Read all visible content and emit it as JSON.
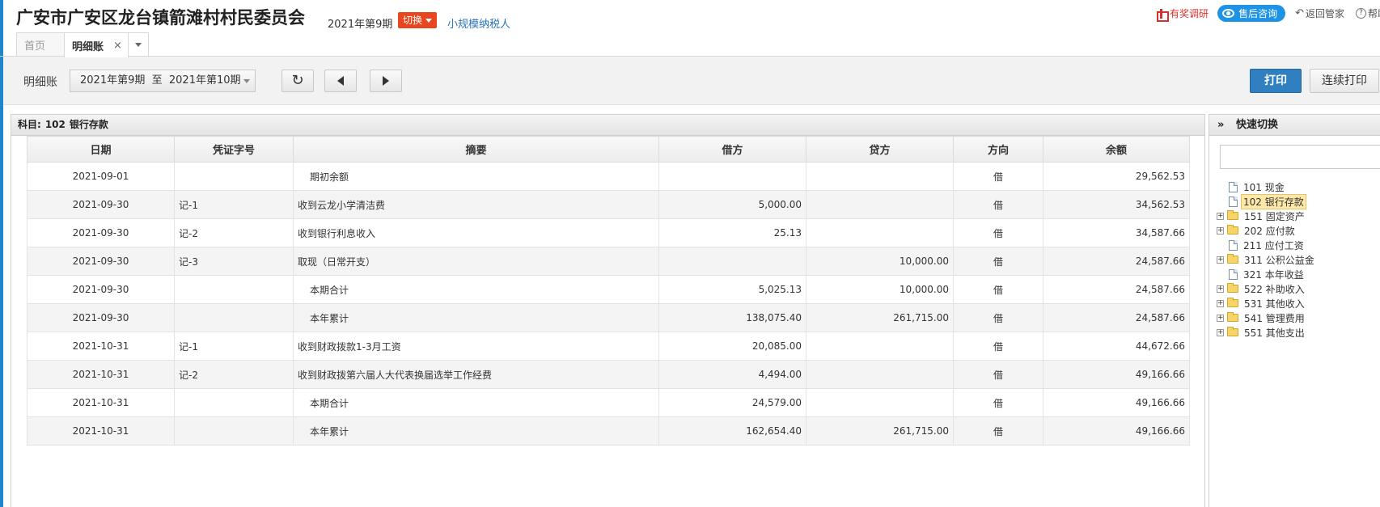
{
  "header": {
    "company": "广安市广安区龙台镇箭滩村村民委员会",
    "period": "2021年第9期",
    "switch_label": "切换",
    "taxpayer": "小规模纳税人",
    "survey": "有奖调研",
    "service": "售后咨询",
    "back": "返回管家",
    "help": "帮助"
  },
  "tabs": {
    "home": "首页",
    "active": "明细账",
    "close": "×"
  },
  "toolbar": {
    "label": "明细账",
    "range": "2021年第9期  至  2021年第10期",
    "print": "打印",
    "continuous_print": "连续打印"
  },
  "main": {
    "subject_prefix": "科目:",
    "subject_code": "102",
    "subject_name": "银行存款",
    "columns": [
      "日期",
      "凭证字号",
      "摘要",
      "借方",
      "贷方",
      "方向",
      "余额"
    ],
    "rows": [
      {
        "date": "2021-09-01",
        "voucher": "",
        "summary": "期初余额",
        "debit": "",
        "credit": "",
        "dir": "借",
        "balance": "29,562.53",
        "indent": true
      },
      {
        "date": "2021-09-30",
        "voucher": "记-1",
        "summary": "收到云龙小学清洁费",
        "debit": "5,000.00",
        "credit": "",
        "dir": "借",
        "balance": "34,562.53",
        "indent": false
      },
      {
        "date": "2021-09-30",
        "voucher": "记-2",
        "summary": "收到银行利息收入",
        "debit": "25.13",
        "credit": "",
        "dir": "借",
        "balance": "34,587.66",
        "indent": false
      },
      {
        "date": "2021-09-30",
        "voucher": "记-3",
        "summary": "取现（日常开支）",
        "debit": "",
        "credit": "10,000.00",
        "dir": "借",
        "balance": "24,587.66",
        "indent": false
      },
      {
        "date": "2021-09-30",
        "voucher": "",
        "summary": "本期合计",
        "debit": "5,025.13",
        "credit": "10,000.00",
        "dir": "借",
        "balance": "24,587.66",
        "indent": true
      },
      {
        "date": "2021-09-30",
        "voucher": "",
        "summary": "本年累计",
        "debit": "138,075.40",
        "credit": "261,715.00",
        "dir": "借",
        "balance": "24,587.66",
        "indent": true
      },
      {
        "date": "2021-10-31",
        "voucher": "记-1",
        "summary": "收到财政拨款1-3月工资",
        "debit": "20,085.00",
        "credit": "",
        "dir": "借",
        "balance": "44,672.66",
        "indent": false
      },
      {
        "date": "2021-10-31",
        "voucher": "记-2",
        "summary": "收到财政拨第六届人大代表换届选举工作经费",
        "debit": "4,494.00",
        "credit": "",
        "dir": "借",
        "balance": "49,166.66",
        "indent": false
      },
      {
        "date": "2021-10-31",
        "voucher": "",
        "summary": "本期合计",
        "debit": "24,579.00",
        "credit": "",
        "dir": "借",
        "balance": "49,166.66",
        "indent": true
      },
      {
        "date": "2021-10-31",
        "voucher": "",
        "summary": "本年累计",
        "debit": "162,654.40",
        "credit": "261,715.00",
        "dir": "借",
        "balance": "49,166.66",
        "indent": true
      }
    ]
  },
  "side": {
    "expand": "»",
    "title": "快速切换",
    "tree": [
      {
        "code": "101",
        "name": "现金",
        "type": "file",
        "toggle": false,
        "selected": false
      },
      {
        "code": "102",
        "name": "银行存款",
        "type": "file",
        "toggle": false,
        "selected": true
      },
      {
        "code": "151",
        "name": "固定资产",
        "type": "folder",
        "toggle": true,
        "selected": false
      },
      {
        "code": "202",
        "name": "应付款",
        "type": "folder",
        "toggle": true,
        "selected": false
      },
      {
        "code": "211",
        "name": "应付工资",
        "type": "file",
        "toggle": false,
        "selected": false
      },
      {
        "code": "311",
        "name": "公积公益金",
        "type": "folder",
        "toggle": true,
        "selected": false
      },
      {
        "code": "321",
        "name": "本年收益",
        "type": "file",
        "toggle": false,
        "selected": false
      },
      {
        "code": "522",
        "name": "补助收入",
        "type": "folder",
        "toggle": true,
        "selected": false
      },
      {
        "code": "531",
        "name": "其他收入",
        "type": "folder",
        "toggle": true,
        "selected": false
      },
      {
        "code": "541",
        "name": "管理费用",
        "type": "folder",
        "toggle": true,
        "selected": false
      },
      {
        "code": "551",
        "name": "其他支出",
        "type": "folder",
        "toggle": true,
        "selected": false
      }
    ]
  },
  "icons": {
    "gift": "gift-icon",
    "service": "eye-icon",
    "back": "undo-icon",
    "help": "help-icon",
    "refresh": "refresh-icon",
    "prev": "arrow-left-icon",
    "next": "arrow-right-icon",
    "folder": "folder-icon",
    "file": "file-icon"
  },
  "colors": {
    "accent": "#2f7fc1",
    "switch": "#e8461e",
    "service": "#1e93e5",
    "survey": "#d8312b",
    "link": "#2b73b7"
  }
}
